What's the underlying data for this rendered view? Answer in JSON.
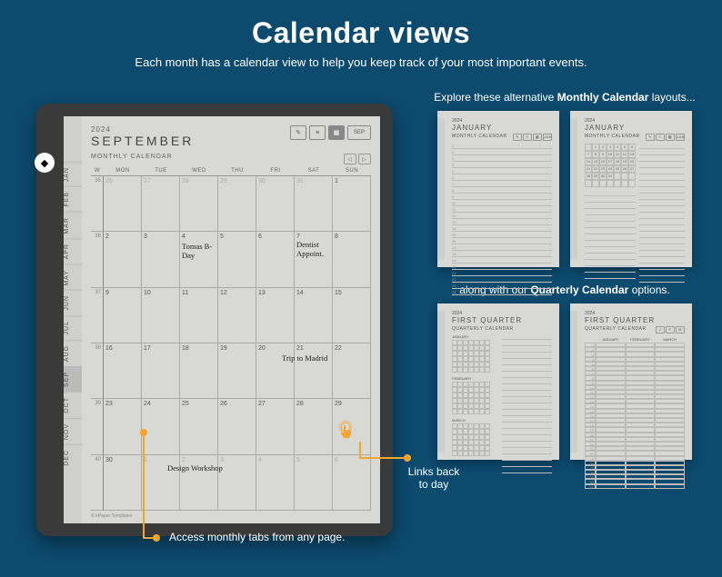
{
  "title": "Calendar views",
  "subtitle": "Each month has a calendar view to help you keep track of your most important events.",
  "tablet": {
    "year": "2024",
    "month": "SEPTEMBER",
    "section": "MONTHLY CALENDAR",
    "month_btn": "SEP",
    "nav_prev": "◁",
    "nav_next": "▷",
    "tabs": [
      "JAN",
      "FEB",
      "MAR",
      "APR",
      "MAY",
      "JUN",
      "JUL",
      "AUG",
      "SEP",
      "OCT",
      "NOV",
      "DEC"
    ],
    "day_headers": [
      "W",
      "MON",
      "TUE",
      "WED",
      "THU",
      "FRI",
      "SAT",
      "SUN"
    ],
    "weeks": [
      "35",
      "36",
      "37",
      "38",
      "39",
      "40"
    ],
    "rows": [
      [
        "26",
        "27",
        "28",
        "29",
        "30",
        "31",
        "1"
      ],
      [
        "2",
        "3",
        "4",
        "5",
        "6",
        "7",
        "8"
      ],
      [
        "9",
        "10",
        "11",
        "12",
        "13",
        "14",
        "15"
      ],
      [
        "16",
        "17",
        "18",
        "19",
        "20",
        "21",
        "22"
      ],
      [
        "23",
        "24",
        "25",
        "26",
        "27",
        "28",
        "29"
      ],
      [
        "30",
        "1",
        "2",
        "3",
        "4",
        "5",
        "6"
      ]
    ],
    "events": {
      "tomas": "Tomas B-Day",
      "dentist": "Dentist Appoint.",
      "trip": "Trip to Madrid",
      "workshop": "Design Workshop"
    },
    "footer": "© ePaper Templates"
  },
  "callouts": {
    "monthly_tabs": "Access monthly tabs from any page.",
    "links_back": "Links back to day"
  },
  "right": {
    "monthly_text_pre": "Explore these alternative ",
    "monthly_text_bold": "Monthly Calendar",
    "monthly_text_post": " layouts...",
    "quarterly_text_pre": "along with our ",
    "quarterly_text_bold": "Quarterly Calendar",
    "quarterly_text_post": " options.",
    "thumb_year": "2024",
    "thumb_jan": "JANUARY",
    "thumb_sub": "MONTHLY CALENDAR",
    "thumb_jan_btn": "JAN",
    "thumb_q1": "FIRST QUARTER",
    "thumb_qsub": "QUARTERLY CALENDAR",
    "q_months": [
      "JANUARY",
      "FEBRUARY",
      "MARCH"
    ],
    "mini_months": [
      "JANUARY",
      "FEBRUARY",
      "MARCH"
    ]
  }
}
